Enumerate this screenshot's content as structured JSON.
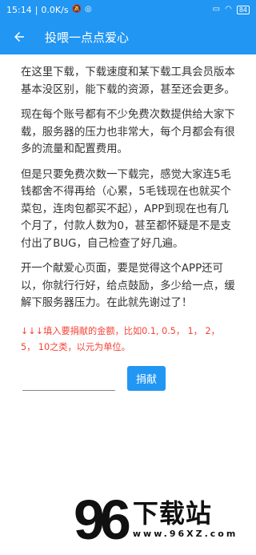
{
  "status_bar": {
    "time": "15:14",
    "net_speed": "0.0K/s",
    "battery": "84"
  },
  "app_bar": {
    "title": "投喂一点点爱心",
    "back_icon": "back-arrow-icon"
  },
  "paragraphs": [
    "在这里下载，下载速度和某下载工具会员版本基本没区别，能下载的资源，甚至还会更多。",
    "现在每个账号都有不少免费次数提供给大家下载，服务器的压力也非常大，每个月都会有很多的流量和配置费用。",
    "但是只要免费次数一下载完，感觉大家连5毛钱都舍不得再给（心累，5毛钱现在也就买个菜包，连肉包都买不起），APP到现在也有几个月了，付款人数为0，甚至都怀疑是不是支付出了BUG，自己检查了好几遍。",
    "开一个献爱心页面，要是觉得这个APP还可以，你就行行好，给点鼓励，多少给一点，缓解下服务器压力。在此就先谢过了！"
  ],
  "hint": "↓↓↓填入要捐献的金额，比如0.1, 0.5， 1， 2， 5， 10之类，以元为单位。",
  "donation": {
    "amount_value": "",
    "button_label": "捐献"
  },
  "watermark": {
    "number": "96",
    "text": "下载站",
    "url": "www.96XZ.com"
  },
  "colors": {
    "primary": "#2196f3",
    "hint": "#f44336",
    "text": "#333333"
  }
}
